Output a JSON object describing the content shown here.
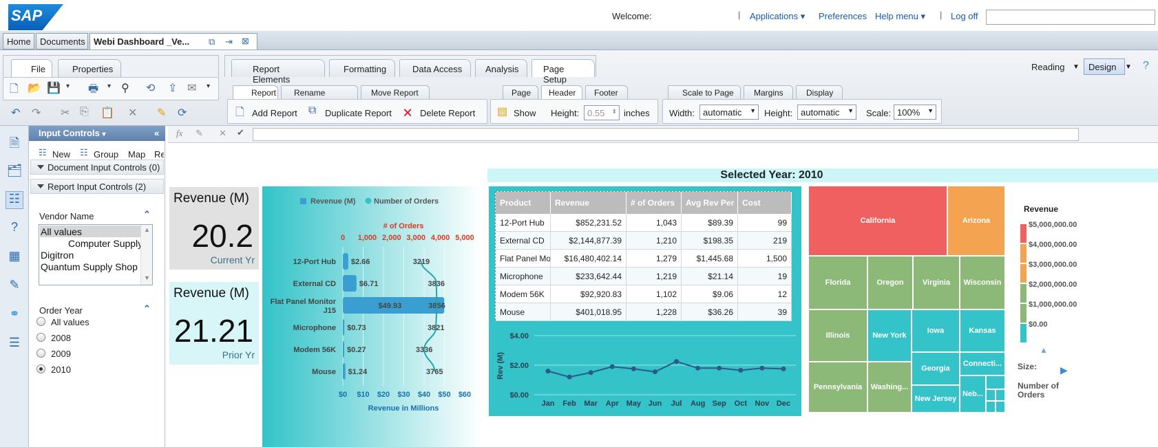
{
  "header": {
    "logo": "SAP",
    "welcome": "Welcome:",
    "links": {
      "applications": "Applications",
      "preferences": "Preferences",
      "help": "Help menu",
      "logoff": "Log off"
    }
  },
  "doc_tabs": {
    "home": "Home",
    "documents": "Documents",
    "active": "Webi Dashboard _Ve..."
  },
  "ribbon": {
    "left_tabs": {
      "file": "File",
      "properties": "Properties"
    },
    "main_tabs": {
      "report_elements": "Report Elements",
      "formatting": "Formatting",
      "data_access": "Data Access",
      "analysis": "Analysis",
      "page_setup": "Page Setup"
    },
    "report_subtabs": {
      "report": "Report",
      "rename": "Rename Report",
      "move": "Move Report"
    },
    "report_buttons": {
      "add": "Add Report",
      "duplicate": "Duplicate Report",
      "delete": "Delete Report"
    },
    "page_subtabs": {
      "page": "Page",
      "header": "Header",
      "footer": "Footer"
    },
    "header_controls": {
      "show": "Show",
      "height_label": "Height:",
      "height_value": "0.55",
      "unit": "inches"
    },
    "scale_subtabs": {
      "scale": "Scale to Page",
      "margins": "Margins",
      "display": "Display"
    },
    "scale_controls": {
      "width_label": "Width:",
      "width_value": "automatic",
      "height_label": "Height:",
      "height_value": "automatic",
      "scale_label": "Scale:",
      "scale_value": "100%"
    },
    "modes": {
      "reading": "Reading",
      "design": "Design"
    }
  },
  "input_controls": {
    "title": "Input Controls",
    "toolbar": {
      "new": "New",
      "group": "Group",
      "map": "Map",
      "re": "Re"
    },
    "doc_section": "Document Input Controls (0)",
    "report_section": "Report Input Controls (2)",
    "vendor": {
      "label": "Vendor Name",
      "items": [
        "All values",
        "Computer Supply",
        "Digitron",
        "Quantum Supply Shop"
      ]
    },
    "year": {
      "label": "Order Year",
      "options": [
        "All values",
        "2008",
        "2009",
        "2010"
      ],
      "selected": "2010"
    }
  },
  "report": {
    "selected_year": "Selected Year: 2010",
    "kpis": [
      {
        "title": "Revenue (M)",
        "value": "20.2",
        "sub": "Current Yr"
      },
      {
        "title": "Revenue (M)",
        "value": "21.21",
        "sub": "Prior Yr"
      }
    ],
    "table": {
      "headers": [
        "Product",
        "Revenue",
        "# of Orders",
        "Avg Rev Per",
        "Cost"
      ],
      "rows": [
        [
          "12-Port Hub",
          "$852,231.52",
          "1,043",
          "$89.39",
          "99"
        ],
        [
          "External CD",
          "$2,144,877.39",
          "1,210",
          "$198.35",
          "219"
        ],
        [
          "Flat Panel Mo",
          "$16,480,402.14",
          "1,279",
          "$1,445.68",
          "1,500"
        ],
        [
          "Microphone",
          "$233,642.44",
          "1,219",
          "$21.14",
          "19"
        ],
        [
          "Modem 56K",
          "$92,920.83",
          "1,102",
          "$9.06",
          "12"
        ],
        [
          "Mouse",
          "$401,018.95",
          "1,228",
          "$36.26",
          "39"
        ]
      ]
    },
    "treemap": {
      "cells": [
        "California",
        "Arizona",
        "Florida",
        "Oregon",
        "Virginia",
        "Wisconsin",
        "Illinois",
        "New York",
        "Iowa",
        "Kansas",
        "Georgia",
        "Connecti...",
        "Pennsylvania",
        "Washing...",
        "New Jersey",
        "Neb..."
      ]
    },
    "legend": {
      "title": "Revenue",
      "levels": [
        "$5,000,000.00",
        "$4,000,000.00",
        "$3,000,000.00",
        "$2,000,000.00",
        "$1,000,000.00",
        "$0.00"
      ],
      "colors": [
        "#f06060",
        "#f4a350",
        "#f4a350",
        "#8cb878",
        "#8cb878",
        "#33c3c8"
      ],
      "size_label": "Size:",
      "size_value": "Number of Orders"
    }
  },
  "chart_data": [
    {
      "type": "bar",
      "legend": [
        "Revenue (M)",
        "Number of Orders"
      ],
      "categories": [
        "12-Port Hub",
        "External CD",
        "Flat Panel Monitor J15",
        "Microphone",
        "Modem 56K",
        "Mouse"
      ],
      "series": [
        {
          "name": "Revenue (M)",
          "values": [
            2.66,
            6.71,
            49.93,
            0.73,
            0.27,
            1.24
          ],
          "labels": [
            "$2.66",
            "$6.71",
            "$49.93",
            "$0.73",
            "$0.27",
            "$1.24"
          ]
        },
        {
          "name": "Number of Orders",
          "values": [
            3219,
            3836,
            3856,
            3821,
            3336,
            3765
          ],
          "labels": [
            "3219",
            "3836",
            "3856",
            "3821",
            "3336",
            "3765"
          ]
        }
      ],
      "xlabel": "Revenue in Millions",
      "x_ticks": [
        "$0",
        "$10",
        "$20",
        "$30",
        "$40",
        "$50",
        "$60"
      ],
      "xlim": [
        0,
        60
      ],
      "x2label": "# of Orders",
      "x2_ticks": [
        "0",
        "1,000",
        "2,000",
        "3,000",
        "4,000",
        "5,000"
      ],
      "x2lim": [
        0,
        5000
      ]
    },
    {
      "type": "line",
      "categories": [
        "Jan",
        "Feb",
        "Mar",
        "Apr",
        "May",
        "Jun",
        "Jul",
        "Aug",
        "Sep",
        "Oct",
        "Nov",
        "Dec"
      ],
      "values": [
        1.6,
        1.2,
        1.5,
        1.9,
        1.75,
        1.55,
        2.25,
        1.8,
        1.8,
        1.65,
        1.8,
        1.75
      ],
      "ylabel": "Rev (M)",
      "y_ticks": [
        "$4.00",
        "$2.00",
        "$0.00"
      ],
      "ylim": [
        0,
        4
      ]
    }
  ]
}
